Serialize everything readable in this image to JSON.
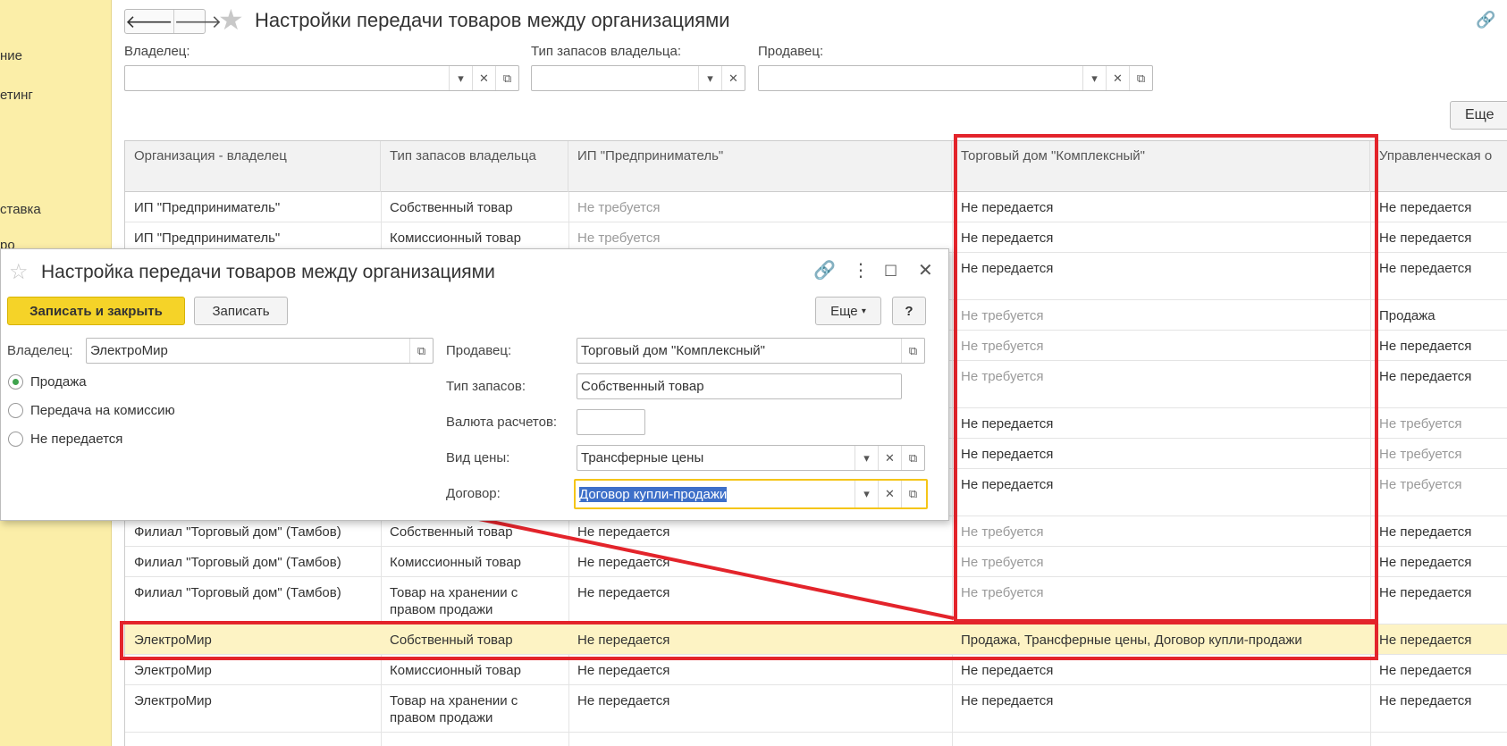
{
  "sidebar": {
    "items": [
      "ние",
      "етинг",
      "ставка",
      "ро"
    ]
  },
  "main": {
    "title": "Настройки передачи товаров между организациями",
    "nav_back": "🡐",
    "nav_forward": "🡒",
    "filters": {
      "owner_label": "Владелец:",
      "stock_type_label": "Тип запасов владельца:",
      "seller_label": "Продавец:",
      "owner_value": "",
      "stock_type_value": "",
      "seller_value": ""
    },
    "more_button": "Еще"
  },
  "table": {
    "columns": [
      "Организация - владелец",
      "Тип запасов владельца",
      "ИП \"Предприниматель\"",
      "Торговый дом \"Комплексный\"",
      "Управленческая о"
    ],
    "rows": [
      {
        "owner": "ИП \"Предприниматель\"",
        "stock": "Собственный товар",
        "c1": "Не требуется",
        "c2": "Не передается",
        "c3": "Не передается"
      },
      {
        "owner": "ИП \"Предприниматель\"",
        "stock": "Комиссионный товар",
        "c1": "Не требуется",
        "c2": "Не передается",
        "c3": "Не передается"
      },
      {
        "owner": "",
        "stock": "",
        "c1": "",
        "c2": "Не передается",
        "c3": "Не передается"
      },
      {
        "owner": "",
        "stock": "",
        "c1": "",
        "c2": "Не требуется",
        "c3": "Продажа"
      },
      {
        "owner": "",
        "stock": "",
        "c1": "",
        "c2": "Не требуется",
        "c3": "Не передается"
      },
      {
        "owner": "",
        "stock": "",
        "c1": "",
        "c2": "Не требуется",
        "c3": "Не передается"
      },
      {
        "owner": "",
        "stock": "",
        "c1": "",
        "c2": "Не передается",
        "c3": "Не требуется"
      },
      {
        "owner": "",
        "stock": "",
        "c1": "",
        "c2": "Не передается",
        "c3": "Не требуется"
      },
      {
        "owner": "",
        "stock": "",
        "c1": "",
        "c2": "Не передается",
        "c3": "Не требуется"
      },
      {
        "owner": "Филиал \"Торговый дом\" (Тамбов)",
        "stock": "Собственный товар",
        "c1": "Не передается",
        "c2": "Не требуется",
        "c3": "Не передается"
      },
      {
        "owner": "Филиал \"Торговый дом\" (Тамбов)",
        "stock": "Комиссионный товар",
        "c1": "Не передается",
        "c2": "Не требуется",
        "c3": "Не передается"
      },
      {
        "owner": "Филиал \"Торговый дом\" (Тамбов)",
        "stock": "Товар на хранении с правом продажи",
        "c1": "Не передается",
        "c2": "Не требуется",
        "c3": "Не передается"
      },
      {
        "owner": "ЭлектроМир",
        "stock": "Собственный товар",
        "c1": "Не передается",
        "c2": "Продажа, Трансферные цены, Договор купли-продажи",
        "c3": "Не передается"
      },
      {
        "owner": "ЭлектроМир",
        "stock": "Комиссионный товар",
        "c1": "Не передается",
        "c2": "Не передается",
        "c3": "Не передается"
      },
      {
        "owner": "ЭлектроМир",
        "stock": "Товар на хранении с правом продажи",
        "c1": "Не передается",
        "c2": "Не передается",
        "c3": "Не передается"
      }
    ]
  },
  "dialog": {
    "title": "Настройка передачи товаров между организациями",
    "save_close": "Записать и закрыть",
    "save": "Записать",
    "more": "Еще",
    "help": "?",
    "owner_label": "Владелец:",
    "owner_value": "ЭлектроМир",
    "radio_options": [
      "Продажа",
      "Передача на комиссию",
      "Не передается"
    ],
    "radio_selected": "Продажа",
    "seller_label": "Продавец:",
    "seller_value": "Торговый дом \"Комплексный\"",
    "stock_label": "Тип запасов:",
    "stock_value": "Собственный товар",
    "currency_label": "Валюта расчетов:",
    "currency_value": "",
    "price_label": "Вид цены:",
    "price_value": "Трансферные цены",
    "contract_label": "Договор:",
    "contract_value": "Договор купли-продажи"
  },
  "colors": {
    "accent_yellow": "#f5d328",
    "annotation_red": "#e3242b",
    "selected_row": "#fdf3c4",
    "sidebar": "#fbeea8"
  }
}
